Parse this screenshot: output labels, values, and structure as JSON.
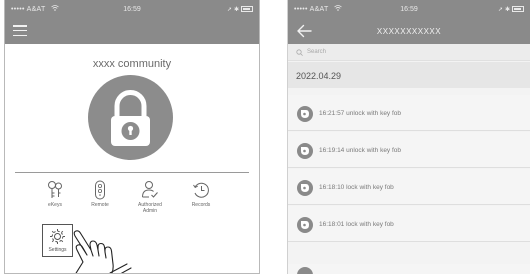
{
  "left_screen": {
    "status_bar": {
      "carrier": "•••••  A&AT",
      "time": "16:59",
      "wifi_icon": "wifi-icon",
      "battery_icon": "battery-icon"
    },
    "navbar": {
      "menu_icon": "hamburger-menu-icon"
    },
    "community_name": "xxxx community",
    "lock_button_icon": "padlock-icon",
    "actions": [
      {
        "label": "eKeys",
        "icon": "ekeys-icon"
      },
      {
        "label": "Remote",
        "icon": "remote-icon"
      },
      {
        "label": "Authorized\nAdmin",
        "icon": "authorized-admin-icon"
      },
      {
        "label": "Records",
        "icon": "records-icon"
      }
    ],
    "settings": {
      "label": "Settings",
      "icon": "gear-icon"
    }
  },
  "right_screen": {
    "status_bar": {
      "carrier": "•••••  A&AT",
      "time": "16:59"
    },
    "navbar": {
      "title": "XXXXXXXXXXX",
      "back_icon": "back-arrow-icon"
    },
    "search_placeholder": "Search",
    "date": "2022.04.29",
    "records": [
      {
        "text": "16:21:57 unlock with key fob"
      },
      {
        "text": "16:19:14 unlock with key fob"
      },
      {
        "text": "16:18:10 lock with key fob"
      },
      {
        "text": "16:18:01 lock with key fob"
      }
    ]
  },
  "colors": {
    "bar_gray": "#8a8a8a",
    "icon_gray": "#8c8c8c",
    "background": "#ffffff"
  }
}
